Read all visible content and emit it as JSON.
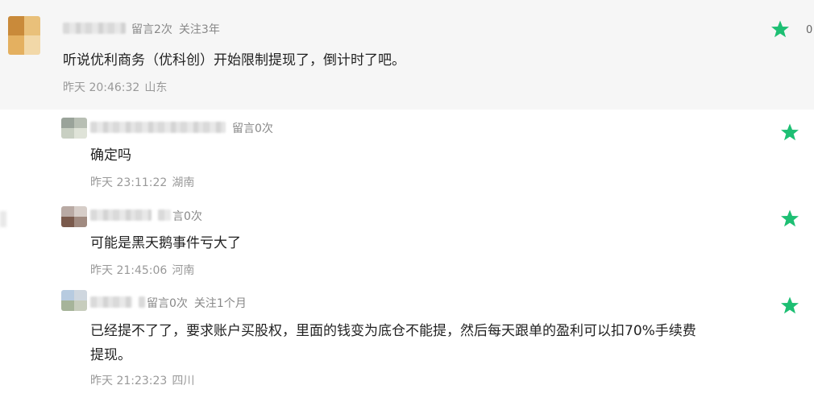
{
  "main_comment": {
    "meta_prefix": "留言2次",
    "meta_follow": "关注3年",
    "text": "听说优利商务（优科创）开始限制提现了，倒计时了吧。",
    "time": "昨天 20:46:32",
    "location": "山东",
    "star_color": "#1dbf73",
    "right_edge_glyph": "0"
  },
  "replies": [
    {
      "meta_prefix": "留言0次",
      "meta_follow": "",
      "text": "确定吗",
      "text_line2": "",
      "time": "昨天 23:11:22",
      "location": "湖南"
    },
    {
      "meta_prefix": "言0次",
      "meta_follow": "",
      "text": "可能是黑天鹅事件亏大了",
      "text_line2": "",
      "time": "昨天 21:45:06",
      "location": "河南"
    },
    {
      "meta_prefix": "留言0次",
      "meta_follow": "关注1个月",
      "text": "已经提不了了，要求账户买股权，里面的钱变为底仓不能提，然后每天跟单的盈利可以扣70%手续费",
      "text_line2": "提现。",
      "time": "昨天 21:23:23",
      "location": "四川"
    }
  ],
  "icons": {
    "star": "star-icon",
    "star_color": "#1dbf73"
  }
}
